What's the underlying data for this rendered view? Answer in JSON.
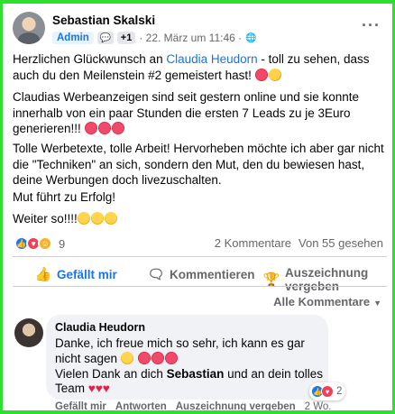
{
  "post": {
    "author": "Sebastian Skalski",
    "badge_admin": "Admin",
    "badge_plus": "+1",
    "timestamp": "· 22. März um 11:46 ·",
    "more_label": "···",
    "p1_before": "Herzlichen Glückwunsch an ",
    "p1_link": "Claudia Heudorn",
    "p1_after": " - toll zu sehen, dass auch du den Meilenstein #2 gemeistert hast! ",
    "p2": "Claudias Werbeanzeigen sind seit gestern online und sie konnte innerhalb von ein paar Stunden die ersten 7 Leads zu je 3Euro generieren!!! ",
    "p3": "Tolle Werbetexte, tolle Arbeit! Hervorheben möchte ich aber gar nicht die \"Techniken\" an sich, sondern den Mut, den du bewiesen hast, deine Werbungen doch livezuschalten.",
    "p4": "Mut führt zu Erfolg!",
    "p5": "Weiter so!!!!"
  },
  "stats": {
    "reactions_count": "9",
    "comments": "2 Kommentare",
    "views": "Von 55 gesehen"
  },
  "actions": {
    "like": "Gefällt mir",
    "comment": "Kommentieren",
    "award": "Auszeichnung vergeben"
  },
  "comments_filter": "Alle Kommentare",
  "comment": {
    "author": "Claudia Heudorn",
    "line1": "Danke, ich freue mich so sehr, ich kann es gar nicht sagen ",
    "line2_before": "Vielen Dank an dich ",
    "line2_bold": "Sebastian",
    "line2_after": " und an dein tolles Team ",
    "reactions_count": "2",
    "like": "Gefällt mir",
    "reply": "Antworten",
    "award": "Auszeichnung vergeben",
    "time": "2 Wo."
  },
  "colors": {
    "accent": "#1b74e4",
    "border": "#2ee02e"
  }
}
